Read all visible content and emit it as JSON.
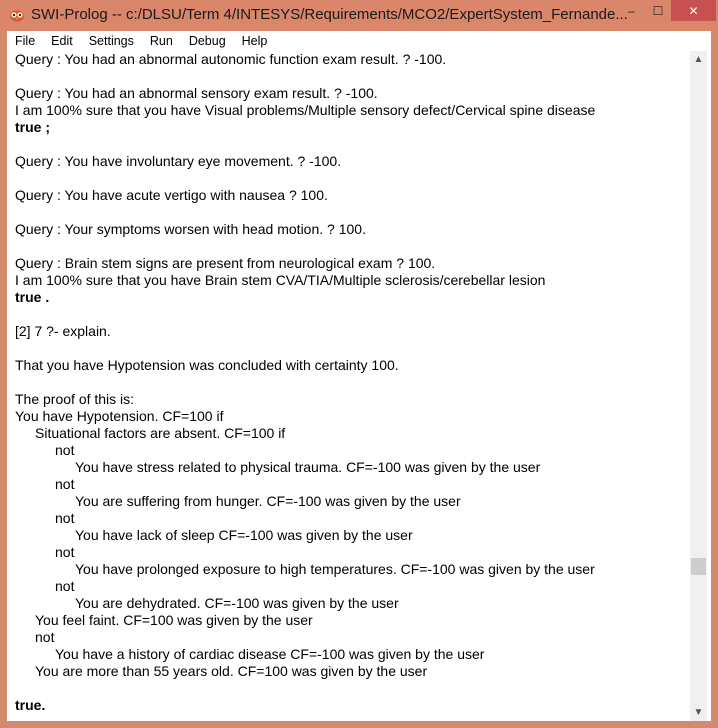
{
  "window": {
    "title": "SWI-Prolog -- c:/DLSU/Term 4/INTESYS/Requirements/MCO2/ExpertSystem_Fernande..."
  },
  "title_buttons": {
    "minimize": "–",
    "maximize": "☐",
    "close": "✕"
  },
  "menu": [
    "File",
    "Edit",
    "Settings",
    "Run",
    "Debug",
    "Help"
  ],
  "icons": {
    "app": "swi-prolog-owl-icon",
    "scroll_up": "▲",
    "scroll_down": "▼"
  },
  "console_lines": [
    {
      "text": "Query : You had an abnormal autonomic function exam result. ? -100.",
      "indent": 0,
      "bold": false
    },
    {
      "text": "",
      "indent": 0,
      "bold": false
    },
    {
      "text": "Query : You had an abnormal sensory exam result. ? -100.",
      "indent": 0,
      "bold": false
    },
    {
      "text": "I am 100% sure that you have Visual problems/Multiple sensory defect/Cervical spine disease",
      "indent": 0,
      "bold": false
    },
    {
      "text": "true ;",
      "indent": 0,
      "bold": true
    },
    {
      "text": "",
      "indent": 0,
      "bold": false
    },
    {
      "text": "Query : You have involuntary eye movement. ? -100.",
      "indent": 0,
      "bold": false
    },
    {
      "text": "",
      "indent": 0,
      "bold": false
    },
    {
      "text": "Query : You have acute vertigo with nausea ? 100.",
      "indent": 0,
      "bold": false
    },
    {
      "text": "",
      "indent": 0,
      "bold": false
    },
    {
      "text": "Query : Your symptoms worsen with head motion. ? 100.",
      "indent": 0,
      "bold": false
    },
    {
      "text": "",
      "indent": 0,
      "bold": false
    },
    {
      "text": "Query : Brain stem signs are present from neurological exam ? 100.",
      "indent": 0,
      "bold": false
    },
    {
      "text": "I am 100% sure that you have Brain stem CVA/TIA/Multiple sclerosis/cerebellar lesion",
      "indent": 0,
      "bold": false
    },
    {
      "text": "true .",
      "indent": 0,
      "bold": true
    },
    {
      "text": "",
      "indent": 0,
      "bold": false
    },
    {
      "text": "[2] 7 ?- explain.",
      "indent": 0,
      "bold": false
    },
    {
      "text": "",
      "indent": 0,
      "bold": false
    },
    {
      "text": "That you have Hypotension was concluded with certainty 100.",
      "indent": 0,
      "bold": false
    },
    {
      "text": "",
      "indent": 0,
      "bold": false
    },
    {
      "text": "The proof of this is:",
      "indent": 0,
      "bold": false
    },
    {
      "text": "You have Hypotension. CF=100 if",
      "indent": 0,
      "bold": false
    },
    {
      "text": "Situational factors are absent. CF=100 if",
      "indent": 1,
      "bold": false
    },
    {
      "text": "not",
      "indent": 2,
      "bold": false
    },
    {
      "text": "You have stress related to physical trauma. CF=-100 was given by the user",
      "indent": 3,
      "bold": false
    },
    {
      "text": "not",
      "indent": 2,
      "bold": false
    },
    {
      "text": "You are suffering from hunger. CF=-100 was given by the user",
      "indent": 3,
      "bold": false
    },
    {
      "text": "not",
      "indent": 2,
      "bold": false
    },
    {
      "text": "You have lack of sleep CF=-100 was given by the user",
      "indent": 3,
      "bold": false
    },
    {
      "text": "not",
      "indent": 2,
      "bold": false
    },
    {
      "text": "You have prolonged exposure to high temperatures. CF=-100 was given by the user",
      "indent": 3,
      "bold": false
    },
    {
      "text": "not",
      "indent": 2,
      "bold": false
    },
    {
      "text": "You are dehydrated. CF=-100 was given by the user",
      "indent": 3,
      "bold": false
    },
    {
      "text": "You feel faint. CF=100 was given by the user",
      "indent": 1,
      "bold": false
    },
    {
      "text": "not",
      "indent": 1,
      "bold": false
    },
    {
      "text": "You have a history of cardiac disease CF=-100 was given by the user",
      "indent": 2,
      "bold": false
    },
    {
      "text": "You are more than 55 years old. CF=100 was given by the user",
      "indent": 1,
      "bold": false
    },
    {
      "text": "",
      "indent": 0,
      "bold": false
    },
    {
      "text": "true.",
      "indent": 0,
      "bold": true
    }
  ],
  "colors": {
    "title_bar": "#d9866b",
    "close_button": "#c75050",
    "console_background": "#ffffff"
  }
}
